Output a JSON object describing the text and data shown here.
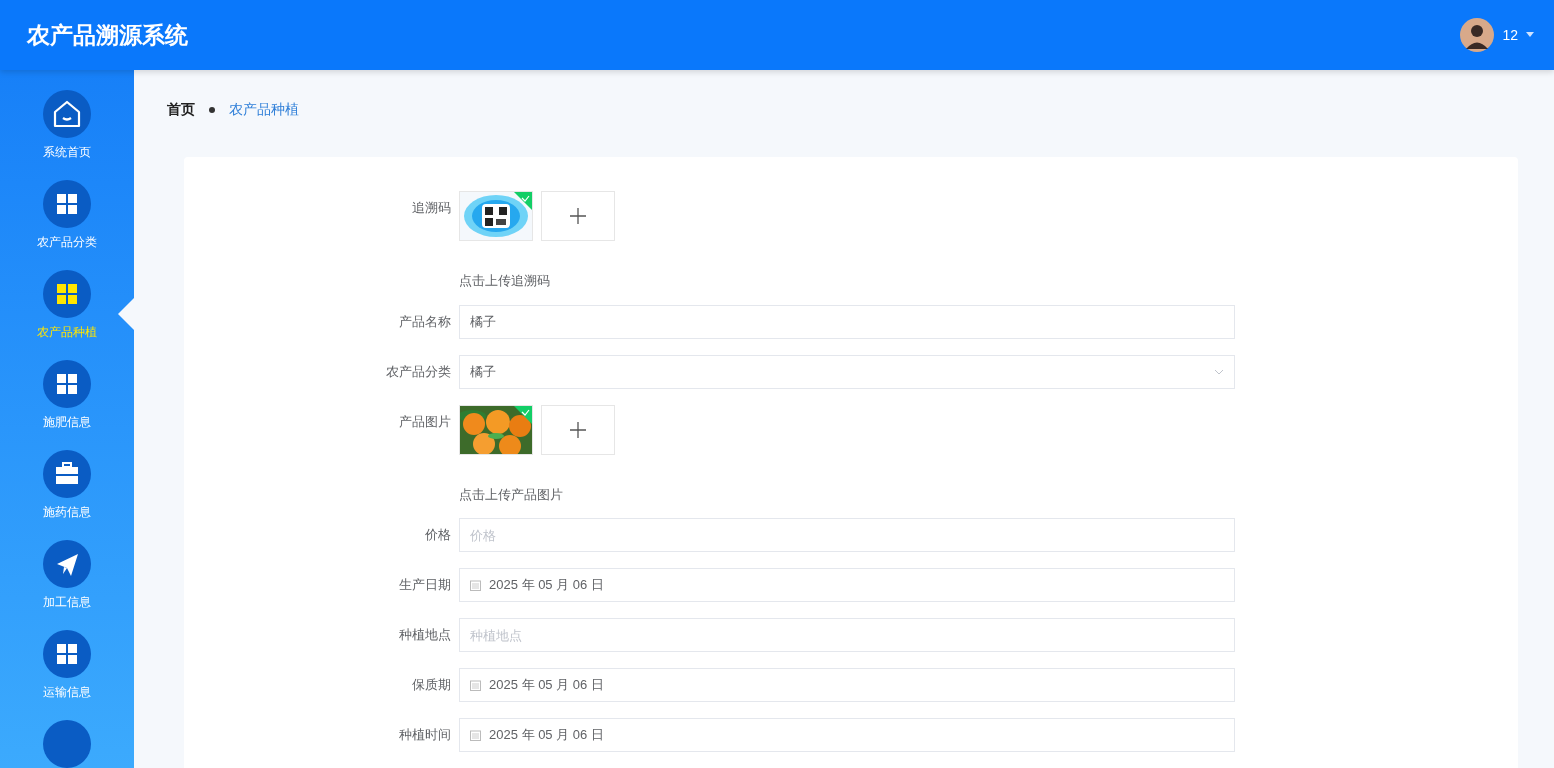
{
  "header": {
    "title": "农产品溯源系统",
    "user": {
      "name": "12"
    }
  },
  "sidebar": {
    "items": [
      {
        "label": "系统首页",
        "selected": false
      },
      {
        "label": "农产品分类",
        "selected": false
      },
      {
        "label": "农产品种植",
        "selected": true
      },
      {
        "label": "施肥信息",
        "selected": false
      },
      {
        "label": "施药信息",
        "selected": false
      },
      {
        "label": "加工信息",
        "selected": false
      },
      {
        "label": "运输信息",
        "selected": false
      }
    ]
  },
  "breadcrumb": [
    {
      "label": "首页"
    },
    {
      "label": "农产品种植"
    }
  ],
  "form": {
    "fields": [
      {
        "kind": "upload",
        "label": "追溯码",
        "hint": "点击上传追溯码"
      },
      {
        "kind": "text",
        "label": "产品名称",
        "value": "橘子"
      },
      {
        "kind": "select",
        "label": "农产品分类",
        "value": "橘子"
      },
      {
        "kind": "upload",
        "label": "产品图片",
        "hint": "点击上传产品图片"
      },
      {
        "kind": "text",
        "label": "价格",
        "placeholder": "价格"
      },
      {
        "kind": "date",
        "label": "生产日期",
        "value": "2025 年 05 月 06 日"
      },
      {
        "kind": "text",
        "label": "种植地点",
        "placeholder": "种植地点"
      },
      {
        "kind": "date",
        "label": "保质期",
        "value": "2025 年 05 月 06 日"
      },
      {
        "kind": "date",
        "label": "种植时间",
        "value": "2025 年 05 月 06 日"
      }
    ]
  }
}
